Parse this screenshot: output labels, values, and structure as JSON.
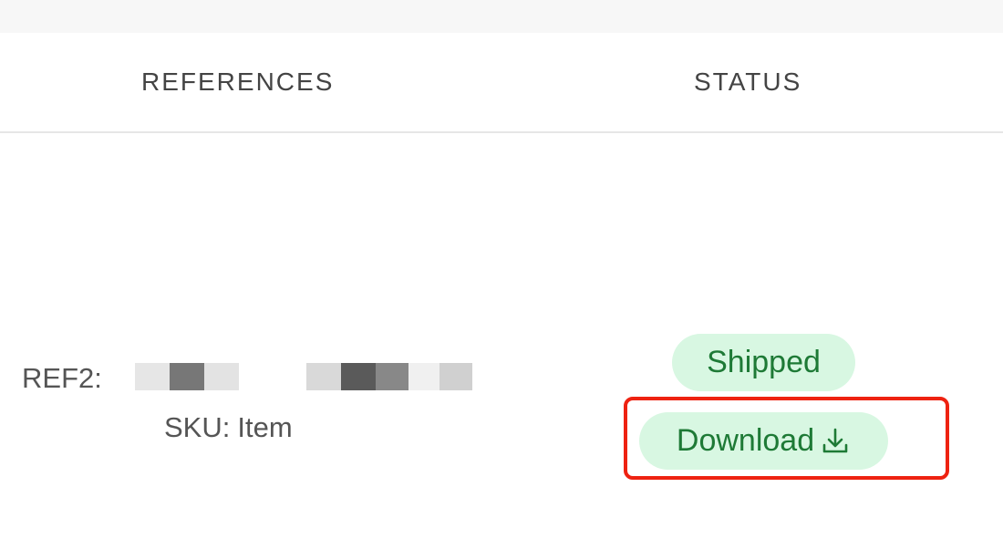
{
  "table": {
    "headers": {
      "references": "REFERENCES",
      "status": "STATUS"
    },
    "row": {
      "ref_label": "REF2:",
      "sku_label": "SKU:",
      "sku_value": "Item",
      "status_badge": "Shipped",
      "download_label": "Download"
    }
  },
  "icons": {
    "download": "download-icon"
  },
  "colors": {
    "badge_bg": "#d8f7e2",
    "badge_text": "#1e7a36",
    "highlight": "#ee2211",
    "header_text": "#444444"
  }
}
